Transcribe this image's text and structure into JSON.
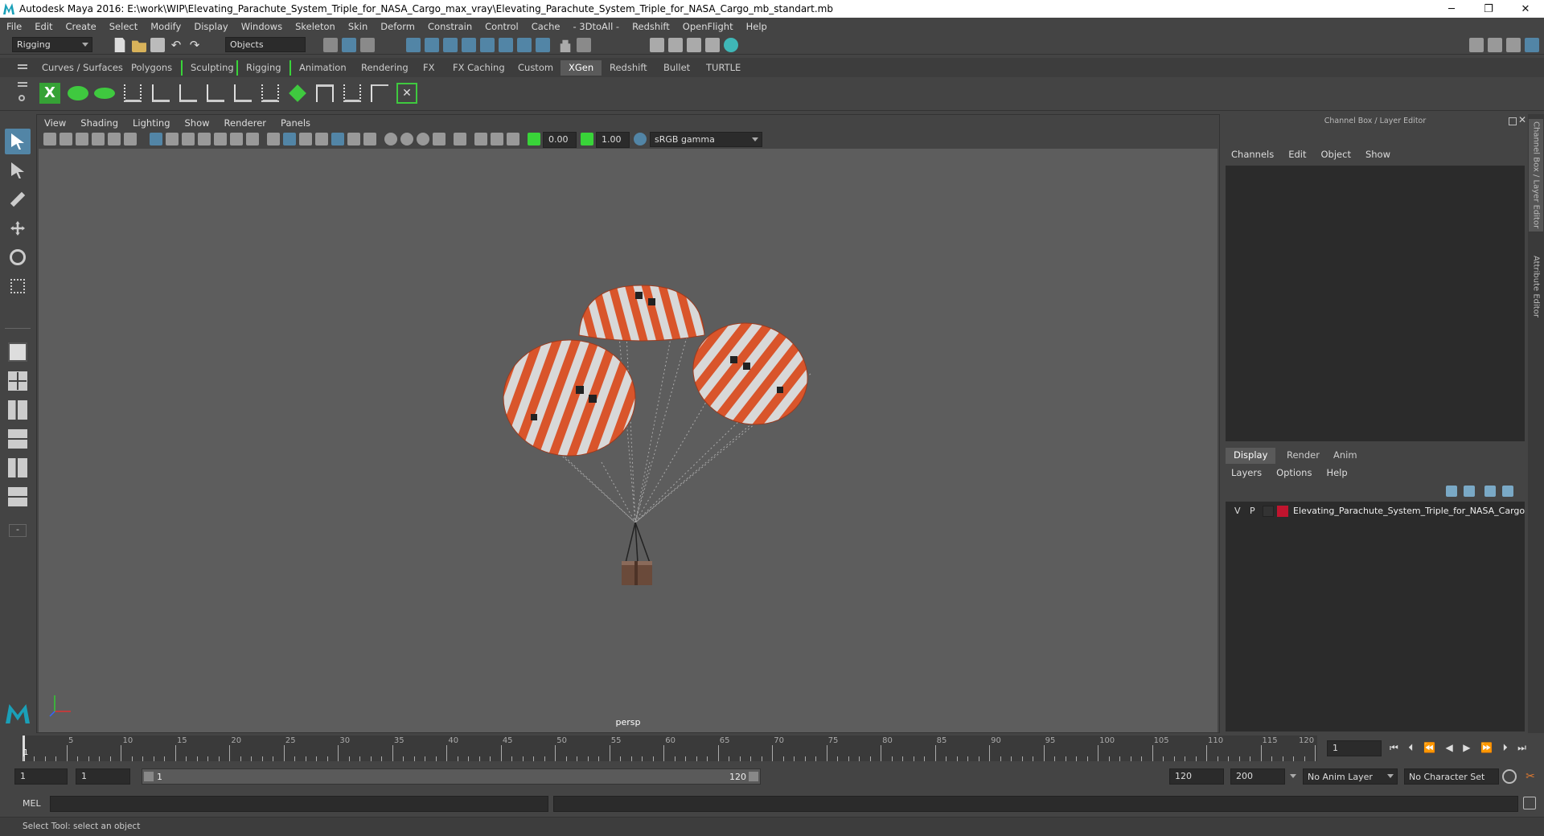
{
  "window": {
    "title": "Autodesk Maya 2016: E:\\work\\WIP\\Elevating_Parachute_System_Triple_for_NASA_Cargo_max_vray\\Elevating_Parachute_System_Triple_for_NASA_Cargo_mb_standart.mb",
    "minimize": "─",
    "maximize": "❐",
    "close": "✕"
  },
  "menubar": [
    "File",
    "Edit",
    "Create",
    "Select",
    "Modify",
    "Display",
    "Windows",
    "Skeleton",
    "Skin",
    "Deform",
    "Constrain",
    "Control",
    "Cache",
    "- 3DtoAll -",
    "Redshift",
    "OpenFlight",
    "Help"
  ],
  "statusline": {
    "mode": "Rigging",
    "selection_mask": "Objects"
  },
  "shelf_tabs": [
    {
      "label": "Curves / Surfaces",
      "active": false
    },
    {
      "label": "Polygons",
      "active": false
    },
    {
      "label": "Sculpting",
      "active": false
    },
    {
      "label": "Rigging",
      "active": false
    },
    {
      "label": "Animation",
      "active": false
    },
    {
      "label": "Rendering",
      "active": false
    },
    {
      "label": "FX",
      "active": false
    },
    {
      "label": "FX Caching",
      "active": false
    },
    {
      "label": "Custom",
      "active": false
    },
    {
      "label": "XGen",
      "active": true
    },
    {
      "label": "Redshift",
      "active": false
    },
    {
      "label": "Bullet",
      "active": false
    },
    {
      "label": "TURTLE",
      "active": false
    }
  ],
  "viewport": {
    "menu": [
      "View",
      "Shading",
      "Lighting",
      "Show",
      "Renderer",
      "Panels"
    ],
    "exposure": "0.00",
    "gamma": "1.00",
    "color_space": "sRGB gamma",
    "camera_label": "persp"
  },
  "channel_box": {
    "header": "Channel Box / Layer Editor",
    "menu": [
      "Channels",
      "Edit",
      "Object",
      "Show"
    ]
  },
  "layer_editor": {
    "tabs": [
      {
        "label": "Display",
        "active": true
      },
      {
        "label": "Render",
        "active": false
      },
      {
        "label": "Anim",
        "active": false
      }
    ],
    "menu": [
      "Layers",
      "Options",
      "Help"
    ],
    "layers": [
      {
        "visible": "V",
        "playback": "P",
        "color": "#c0142e",
        "name": "Elevating_Parachute_System_Triple_for_NASA_Cargo"
      }
    ]
  },
  "side_tabs": [
    "Channel Box / Layer Editor",
    "Attribute Editor"
  ],
  "timeline": {
    "start": 1,
    "end": 120,
    "current_frame": "1",
    "labels": [
      "5",
      "10",
      "15",
      "20",
      "25",
      "30",
      "35",
      "40",
      "45",
      "50",
      "55",
      "60",
      "65",
      "70",
      "75",
      "80",
      "85",
      "90",
      "95",
      "100",
      "105",
      "110",
      "115",
      "120"
    ]
  },
  "range": {
    "start_time": "1",
    "playback_start": "1",
    "slider_start": "1",
    "slider_end": "120",
    "playback_end": "120",
    "end_time": "200",
    "anim_layer": "No Anim Layer",
    "character_set": "No Character Set"
  },
  "command_line": {
    "label": "MEL"
  },
  "help_line": "Select Tool: select an object",
  "colors": {
    "accent_tab": "#5a5a5a",
    "active_tool": "#5285a6",
    "parachute_orange": "#d9552b",
    "parachute_white": "#d8d8d8",
    "layer_color": "#c0142e"
  }
}
